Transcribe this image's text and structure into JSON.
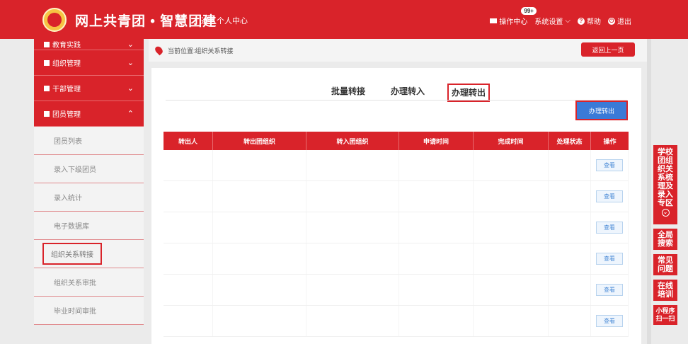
{
  "header": {
    "site_title": "网上共青团 • 智慧团建",
    "personal_center": "进入个人中心",
    "ops_center": "操作中心",
    "ops_badge": "99+",
    "settings": "系统设置",
    "help": "帮助",
    "logout": "退出"
  },
  "sidebar": {
    "top_items": [
      {
        "label": "教育实践"
      },
      {
        "label": "组织管理"
      },
      {
        "label": "干部管理"
      },
      {
        "label": "团员管理"
      }
    ],
    "sub_items": [
      {
        "label": "团员列表"
      },
      {
        "label": "录入下级团员"
      },
      {
        "label": "录入统计"
      },
      {
        "label": "电子数据库"
      },
      {
        "label": "组织关系转接"
      },
      {
        "label": "组织关系审批"
      },
      {
        "label": "毕业时间审批"
      }
    ]
  },
  "breadcrumb": {
    "text": "当前位置:组织关系转接",
    "back_label": "返回上一页"
  },
  "tabs": [
    "批量转接",
    "办理转入",
    "办理转出"
  ],
  "action_button": "办理转出",
  "table": {
    "headers": [
      "转出人",
      "转出团组织",
      "转入团组织",
      "申请时间",
      "完成时间",
      "处理状态",
      "操作"
    ],
    "view_label": "查看",
    "row_count": 6
  },
  "floatbar": {
    "special_zone": "学校团组织关系梳理及录入专区",
    "search": "全局搜索",
    "faq": "常见问题",
    "training": "在线培训",
    "miniprogram": "小程序扫一扫"
  },
  "colors": {
    "primary_red": "#d9232a",
    "action_blue": "#3a7ad7"
  }
}
